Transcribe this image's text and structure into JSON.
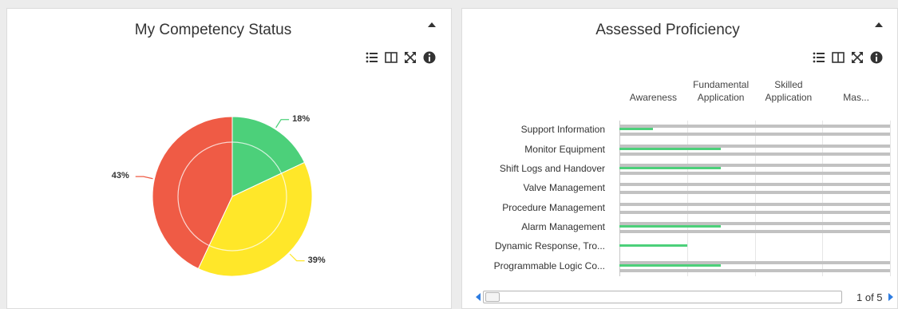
{
  "left_panel": {
    "title": "My Competency Status",
    "toolbar_icons": [
      "list-icon",
      "columns-icon",
      "expand-icon",
      "info-icon"
    ]
  },
  "right_panel": {
    "title": "Assessed Proficiency",
    "toolbar_icons": [
      "list-icon",
      "columns-icon",
      "expand-icon",
      "info-icon"
    ],
    "pager": {
      "label": "1 of 5"
    }
  },
  "colors": {
    "green": "#4cd07a",
    "yellow": "#ffe729",
    "red": "#ef5b45",
    "grey_bar": "#c2c2c2"
  },
  "chart_data": [
    {
      "type": "pie",
      "title": "My Competency Status",
      "slices": [
        {
          "label": "18%",
          "value": 18,
          "color": "#4cd07a"
        },
        {
          "label": "39%",
          "value": 39,
          "color": "#ffe729"
        },
        {
          "label": "43%",
          "value": 43,
          "color": "#ef5b45"
        }
      ]
    },
    {
      "type": "bar",
      "title": "Assessed Proficiency",
      "orientation": "horizontal",
      "levels": [
        "Awareness",
        "Fundamental Application",
        "Skilled Application",
        "Mas..."
      ],
      "level_labels": [
        {
          "line1": "",
          "line2": "Awareness"
        },
        {
          "line1": "Fundamental",
          "line2": "Application"
        },
        {
          "line1": "Skilled",
          "line2": "Application"
        },
        {
          "line1": "",
          "line2": "Mas..."
        }
      ],
      "xlim": [
        0,
        4
      ],
      "categories": [
        "Support Information",
        "Monitor Equipment",
        "Shift Logs and Handover",
        "Valve Management",
        "Procedure Management",
        "Alarm Management",
        "Dynamic Response, Tro...",
        "Programmable Logic Co..."
      ],
      "series": [
        {
          "values": [
            4,
            4,
            4,
            4,
            4,
            4,
            0,
            4
          ]
        },
        {
          "values": [
            0.5,
            1.5,
            1.5,
            0,
            0,
            1.5,
            1.0,
            1.5
          ]
        }
      ]
    }
  ]
}
